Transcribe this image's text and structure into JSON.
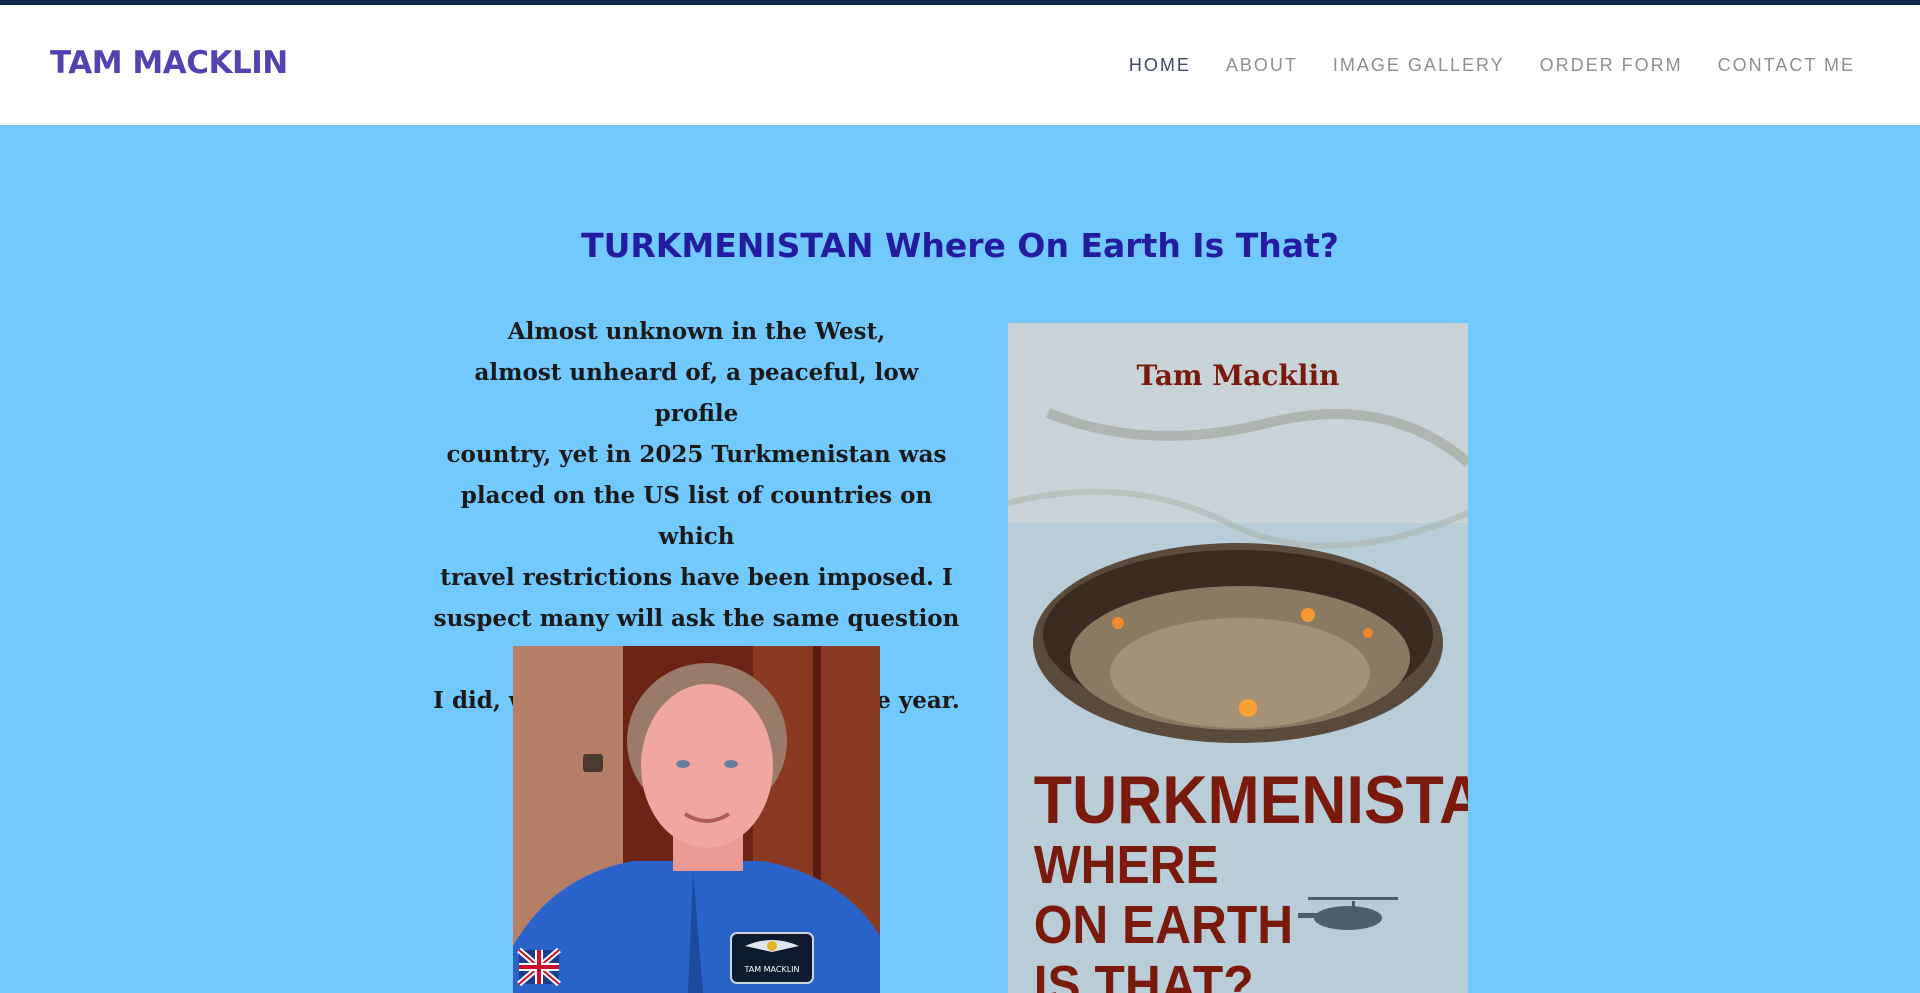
{
  "site": {
    "brand": "TAM MACKLIN",
    "nav": [
      "HOME",
      "ABOUT",
      "IMAGE GALLERY",
      "ORDER FORM",
      "CONTACT ME"
    ]
  },
  "main": {
    "title": "TURKMENISTAN Where On Earth Is That?",
    "intro_lines": [
      "Almost unknown in the West,",
      "almost unheard of, a peaceful, low profile",
      "country, yet in 2025 Turkmenistan was",
      "placed on the US list of countries on which",
      "travel restrictions have been imposed. I",
      "suspect many will ask the same question as",
      "I did, when I was sent there for one year."
    ],
    "portrait": {
      "badge_text": "TAM MACKLIN"
    },
    "book_cover": {
      "author": "Tam Macklin",
      "title_lines": [
        "TURKMENISTAN,",
        "WHERE",
        "ON EARTH",
        "IS THAT?"
      ]
    }
  },
  "colors": {
    "background": "#72c9fd",
    "brand": "#5641b0",
    "title": "#231ba0",
    "topbar": "#0b2748",
    "cover_text": "#7a1a0c"
  }
}
